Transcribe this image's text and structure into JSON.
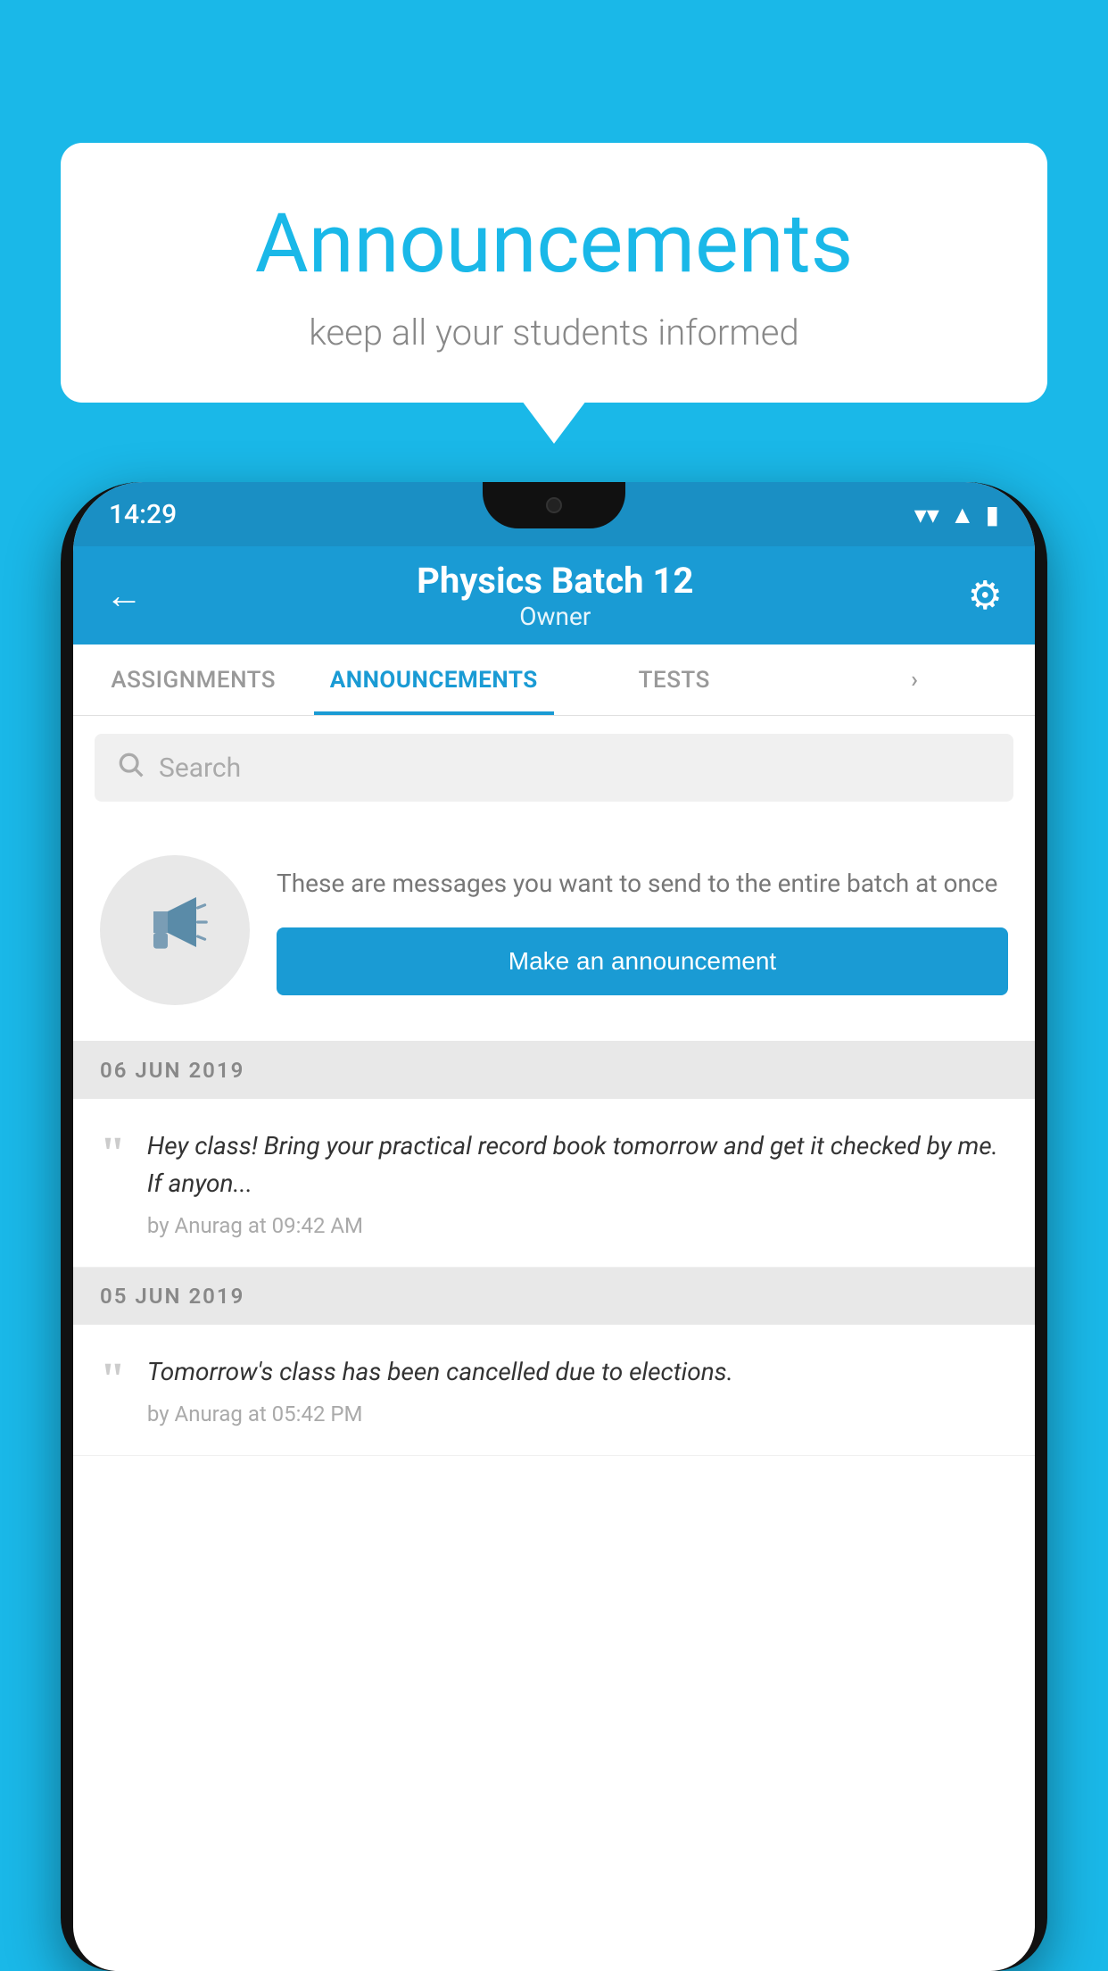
{
  "background_color": "#1ab8e8",
  "speech_bubble": {
    "title": "Announcements",
    "subtitle": "keep all your students informed"
  },
  "phone": {
    "status_bar": {
      "time": "14:29",
      "wifi": "▼",
      "signal": "▲",
      "battery": "▮"
    },
    "header": {
      "title": "Physics Batch 12",
      "subtitle": "Owner",
      "back_label": "←",
      "gear_label": "⚙"
    },
    "tabs": [
      {
        "label": "ASSIGNMENTS",
        "active": false
      },
      {
        "label": "ANNOUNCEMENTS",
        "active": true
      },
      {
        "label": "TESTS",
        "active": false
      },
      {
        "label": "···",
        "active": false
      }
    ],
    "search": {
      "placeholder": "Search"
    },
    "announcement_prompt": {
      "description": "These are messages you want to send to the entire batch at once",
      "button_label": "Make an announcement"
    },
    "announcements": [
      {
        "date": "06  JUN  2019",
        "items": [
          {
            "message": "Hey class! Bring your practical record book tomorrow and get it checked by me. If anyon...",
            "meta": "by Anurag at 09:42 AM"
          }
        ]
      },
      {
        "date": "05  JUN  2019",
        "items": [
          {
            "message": "Tomorrow's class has been cancelled due to elections.",
            "meta": "by Anurag at 05:42 PM"
          }
        ]
      }
    ]
  }
}
